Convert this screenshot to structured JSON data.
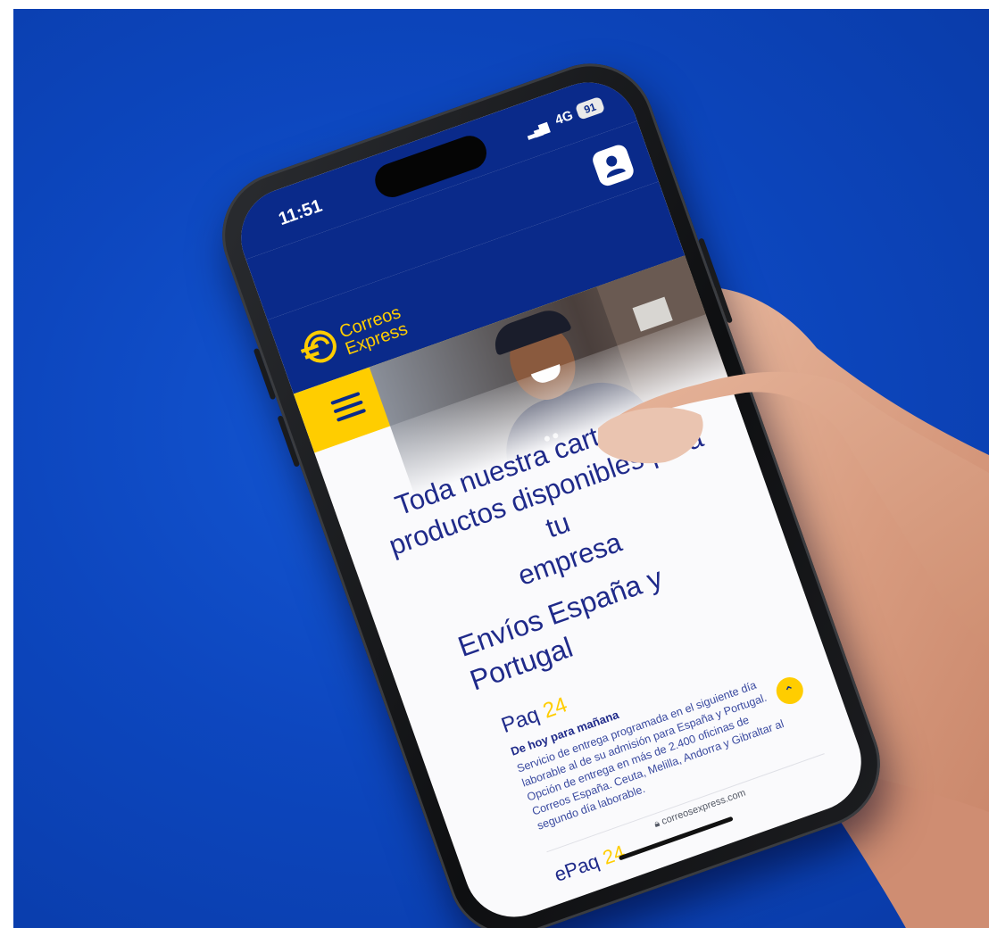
{
  "status_bar": {
    "time": "11:51",
    "network": "4G",
    "battery": "91"
  },
  "brand": {
    "name_line1": "Correos",
    "name_line2": "Express",
    "colors": {
      "navy": "#0a2a8a",
      "yellow": "#ffcd00"
    }
  },
  "icons": [
    "user-icon",
    "menu-icon",
    "chevron-up-icon",
    "lock-icon",
    "correos-logo-icon"
  ],
  "hero": {
    "headline_lines": [
      "Toda nuestra cartera de",
      "productos disponibles para tu",
      "empresa"
    ]
  },
  "section": {
    "title_line1": "Envíos España y",
    "title_line2": "Portugal"
  },
  "products": [
    {
      "name": "Paq",
      "number": "24",
      "subtitle": "De hoy para mañana",
      "description": "Servicio de entrega programada en el siguiente día laborable al de su admisión para España y Portugal. Opción de entrega en más de 2.400 oficinas de Correos España. Ceuta, Melilla, Andorra y Gibraltar al segundo día laborable."
    },
    {
      "name": "ePaq",
      "number": "24"
    }
  ],
  "browser": {
    "url": "correosexpress.com"
  }
}
